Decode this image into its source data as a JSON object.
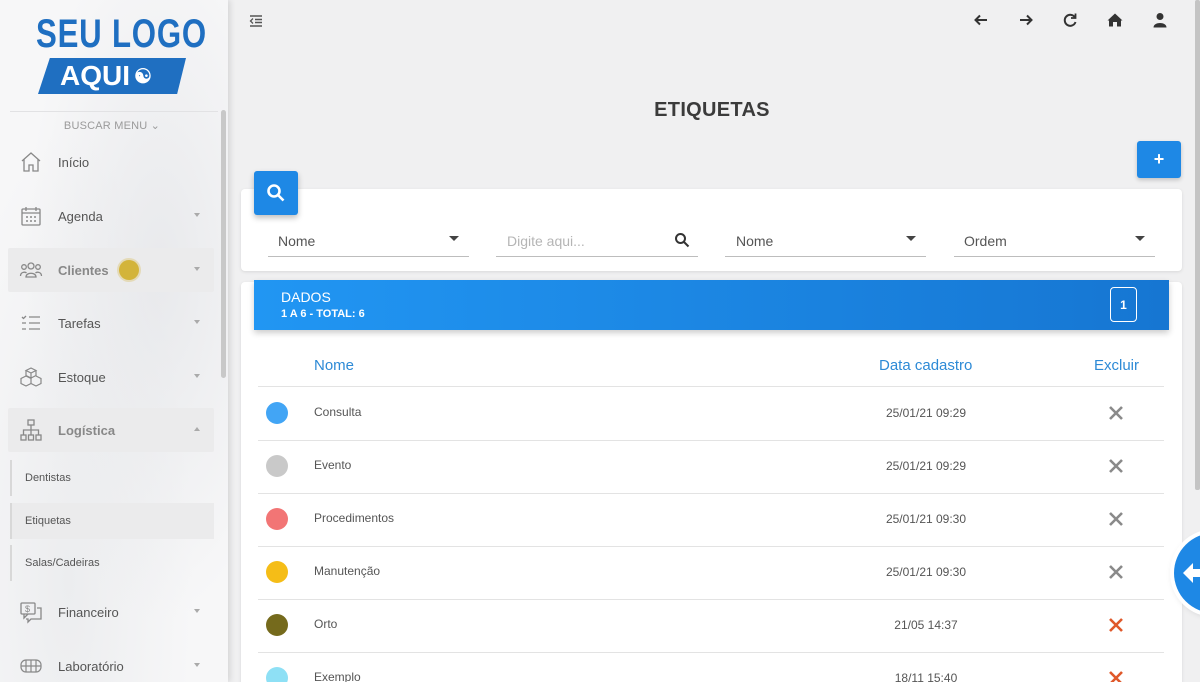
{
  "logo": {
    "line1": "SEU LOGO",
    "line2": "AQUI"
  },
  "sidebar": {
    "search_menu": "BUSCAR MENU ⌄",
    "items": [
      {
        "label": "Início",
        "icon": "home-icon"
      },
      {
        "label": "Agenda",
        "icon": "calendar-icon"
      },
      {
        "label": "Clientes",
        "icon": "users-icon"
      },
      {
        "label": "Tarefas",
        "icon": "tasks-icon"
      },
      {
        "label": "Estoque",
        "icon": "boxes-icon"
      },
      {
        "label": "Logística",
        "icon": "sitemap-icon"
      },
      {
        "label": "Financeiro",
        "icon": "money-chat-icon"
      },
      {
        "label": "Laboratório",
        "icon": "teeth-icon"
      }
    ],
    "submenu": [
      "Dentistas",
      "Etiquetas",
      "Salas/Cadeiras"
    ]
  },
  "page": {
    "title": "ETIQUETAS",
    "add_label": "+"
  },
  "filters": {
    "field1": "Nome",
    "search_placeholder": "Digite aqui...",
    "field2": "Nome",
    "field3": "Ordem"
  },
  "data_panel": {
    "title": "DADOS",
    "subtitle": "1 A 6 - TOTAL: 6",
    "page": "1"
  },
  "table": {
    "headers": {
      "name": "Nome",
      "date": "Data cadastro",
      "delete": "Excluir"
    },
    "rows": [
      {
        "name": "Consulta",
        "date": "25/01/21 09:29",
        "color": "#42a5f5",
        "delete_color": "#8a8a8a"
      },
      {
        "name": "Evento",
        "date": "25/01/21 09:29",
        "color": "#c9c9c9",
        "delete_color": "#8a8a8a"
      },
      {
        "name": "Procedimentos",
        "date": "25/01/21 09:30",
        "color": "#f27575",
        "delete_color": "#8a8a8a"
      },
      {
        "name": "Manutenção",
        "date": "25/01/21 09:30",
        "color": "#f5bd17",
        "delete_color": "#8a8a8a"
      },
      {
        "name": "Orto",
        "date": "21/05 14:37",
        "color": "#756a1c",
        "delete_color": "#e0582a"
      },
      {
        "name": "Exemplo",
        "date": "18/11 15:40",
        "color": "#8ee0f5",
        "delete_color": "#e0582a"
      }
    ]
  },
  "colors": {
    "primary": "#1e88e5",
    "header_text": "#2d8ad6",
    "badge": "#d3b43a"
  }
}
